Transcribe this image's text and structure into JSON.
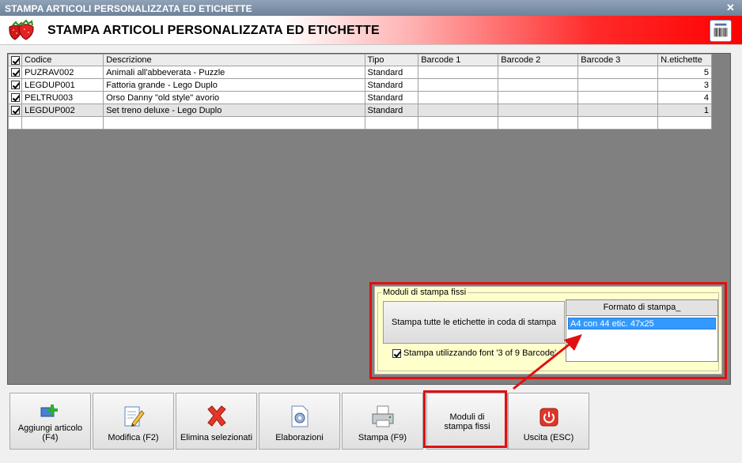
{
  "window": {
    "title": "STAMPA ARTICOLI PERSONALIZZATA ED ETICHETTE"
  },
  "header": {
    "title": "STAMPA ARTICOLI PERSONALIZZATA ED ETICHETTE",
    "logo_icon": "strawberries-icon",
    "right_icon": "barcode-icon",
    "accent_color": "#ff0000"
  },
  "grid": {
    "columns": [
      "Codice",
      "Descrizione",
      "Tipo",
      "Barcode 1",
      "Barcode 2",
      "Barcode 3",
      "N.etichette"
    ],
    "rows": [
      {
        "checked": true,
        "codice": "PUZRAV002",
        "descrizione": "Animali all'abbeverata - Puzzle",
        "tipo": "Standard",
        "barcode1": "",
        "barcode2": "",
        "barcode3": "",
        "n": "5"
      },
      {
        "checked": true,
        "codice": "LEGDUP001",
        "descrizione": "Fattoria grande - Lego Duplo",
        "tipo": "Standard",
        "barcode1": "",
        "barcode2": "",
        "barcode3": "",
        "n": "3"
      },
      {
        "checked": true,
        "codice": "PELTRU003",
        "descrizione": "Orso Danny \"old style\" avorio",
        "tipo": "Standard",
        "barcode1": "",
        "barcode2": "",
        "barcode3": "",
        "n": "4"
      },
      {
        "checked": true,
        "codice": "LEGDUP002",
        "descrizione": "Set treno deluxe - Lego Duplo",
        "tipo": "Standard",
        "barcode1": "",
        "barcode2": "",
        "barcode3": "",
        "n": "1"
      }
    ]
  },
  "moduli": {
    "legend": "Moduli di stampa fissi",
    "print_all_label": "Stampa tutte le etichette in coda di stampa",
    "font_checkbox_label": "Stampa utilizzando font '3 of 9 Barcode'",
    "font_checkbox_checked": true,
    "formato_header": "Formato di stampa_",
    "formato_selected": "A4 con 44 etic. 47x25"
  },
  "toolbar": {
    "aggiungi": "Aggiungi articolo (F4)",
    "modifica": "Modifica (F2)",
    "elimina": "Elimina selezionati",
    "elaborazioni": "Elaborazioni",
    "stampa": "Stampa (F9)",
    "moduli": "Moduli di stampa fissi",
    "uscita": "Uscita (ESC)"
  },
  "annotation_color": "#e01010"
}
